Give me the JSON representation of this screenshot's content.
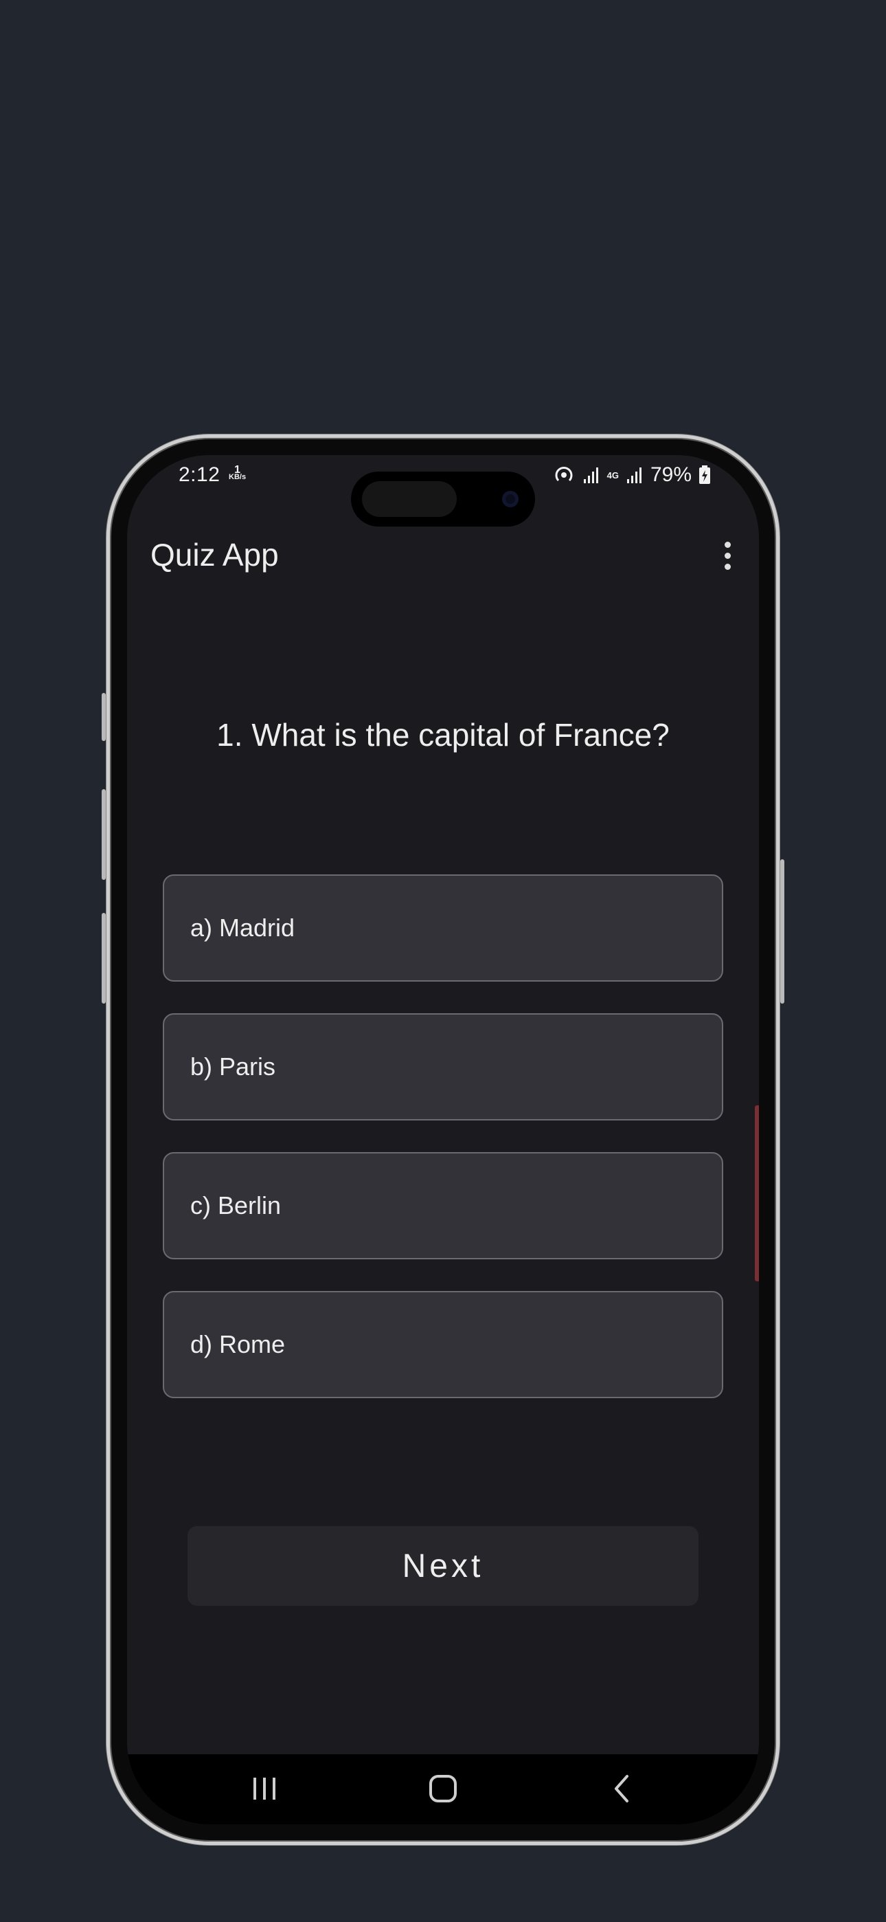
{
  "status_bar": {
    "time": "2:12",
    "net_speed_value": "1",
    "net_speed_unit": "KB/s",
    "network_type": "4G",
    "battery": "79%"
  },
  "app_bar": {
    "title": "Quiz App",
    "menu_icon": "more-vert-icon"
  },
  "quiz": {
    "question": "1. What is the capital of France?",
    "options": [
      {
        "label": "a) Madrid"
      },
      {
        "label": "b) Paris"
      },
      {
        "label": "c) Berlin"
      },
      {
        "label": "d) Rome"
      }
    ],
    "next_label": "Next"
  },
  "nav_bar": {
    "icons": [
      "recents-icon",
      "home-icon",
      "back-icon"
    ]
  },
  "colors": {
    "page_background": "#22262e",
    "screen_background": "#1b1b1f",
    "option_background": "#333238",
    "option_border": "#6b6a70",
    "next_background": "#26262b",
    "text": "#eeeeee"
  }
}
